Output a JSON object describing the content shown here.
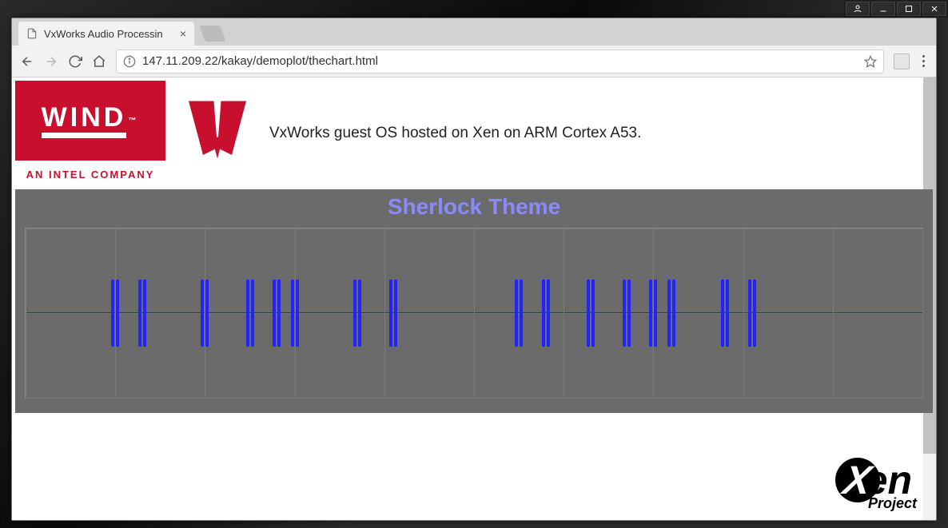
{
  "window": {
    "titlebar": {
      "user_icon": "user",
      "minimize": "minimize",
      "maximize": "maximize",
      "close": "close"
    }
  },
  "browser": {
    "tab": {
      "title": "VxWorks Audio Processin"
    },
    "nav": {
      "back": "back",
      "forward": "forward",
      "reload": "reload",
      "home": "home"
    },
    "address": {
      "url": "147.11.209.22/kakay/demoplot/thechart.html"
    },
    "menu": "menu"
  },
  "page": {
    "wind_logo": {
      "text": "WIND",
      "tm": "™",
      "subtitle": "AN INTEL COMPANY"
    },
    "header_text": "VxWorks guest OS hosted on Xen on ARM Cortex A53.",
    "xen_logo": {
      "x": "X",
      "en": "en",
      "project": "Project"
    }
  },
  "chart_data": {
    "type": "line",
    "title": "Sherlock Theme",
    "xlabel": "",
    "ylabel": "",
    "xlim": [
      0,
      100
    ],
    "ylim": [
      -1,
      1
    ],
    "grid": true,
    "baseline": 0,
    "spike_amplitude": 0.4,
    "spike_positions_pct": [
      10,
      13,
      20,
      25,
      28,
      30,
      37,
      41,
      55,
      58,
      63,
      67,
      70,
      72,
      78,
      81
    ],
    "grid_v_pct": [
      0,
      10,
      20,
      30,
      40,
      50,
      60,
      70,
      80,
      90,
      100
    ],
    "grid_h_pct": [
      0,
      50,
      100
    ]
  }
}
